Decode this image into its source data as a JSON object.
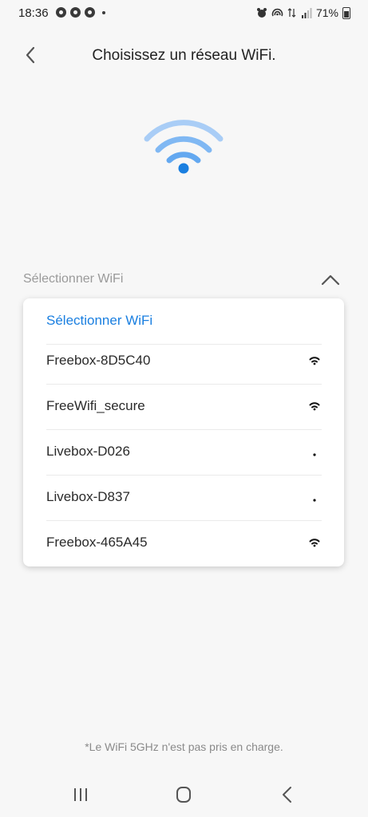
{
  "status": {
    "time": "18:36",
    "battery": "71%"
  },
  "header": {
    "title": "Choisissez un réseau WiFi."
  },
  "select": {
    "label": "Sélectionner WiFi"
  },
  "dropdown": {
    "items": [
      {
        "label": "Sélectionner WiFi",
        "selected": true
      },
      {
        "label": "Freebox-8D5C40",
        "signal": "strong"
      },
      {
        "label": "FreeWifi_secure",
        "signal": "strong"
      },
      {
        "label": "Livebox-D026",
        "signal": "weak"
      },
      {
        "label": "Livebox-D837",
        "signal": "weak"
      },
      {
        "label": "Freebox-465A45",
        "signal": "strong"
      }
    ]
  },
  "footnote": "*Le WiFi 5GHz n'est pas pris en charge.",
  "colors": {
    "accent": "#1a7fe0",
    "wifi_light": "#a9cdf6",
    "wifi_mid": "#63a8f0",
    "wifi_dot": "#1a7fe0"
  }
}
